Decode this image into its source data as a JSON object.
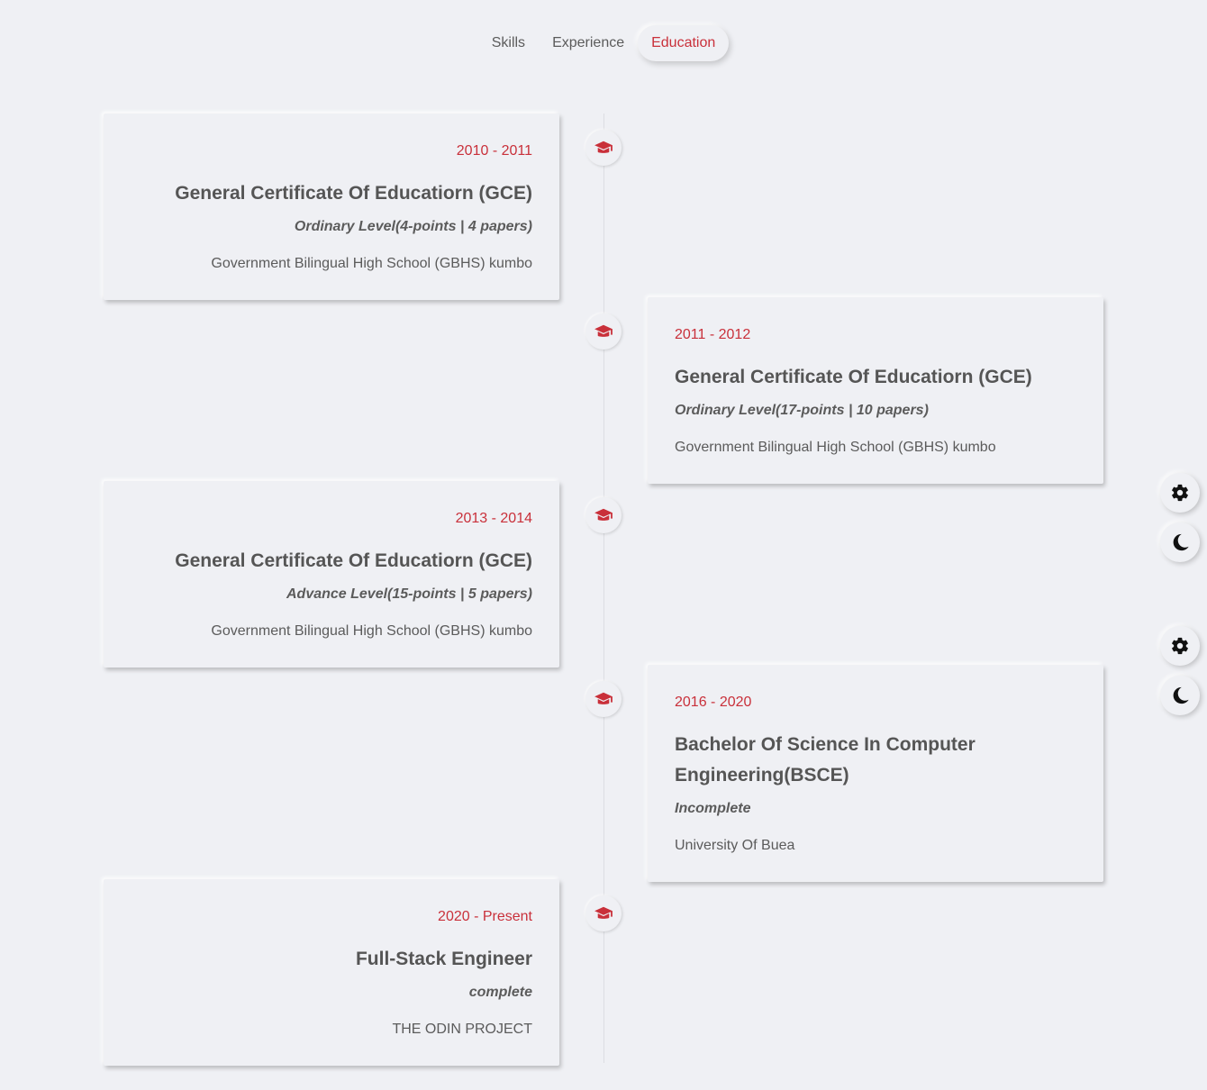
{
  "tabs": [
    {
      "label": "Skills"
    },
    {
      "label": "Experience"
    },
    {
      "label": "Education"
    }
  ],
  "active_tab": "Education",
  "accent_color": "#c9303a",
  "icons": {
    "timeline_marker": "graduation-cap-icon",
    "settings": "gear-icon",
    "theme": "moon-icon"
  },
  "education": [
    {
      "date": "2010 - 2011",
      "title": "General Certificate Of Educatiorn (GCE)",
      "level": "Ordinary Level(4-points | 4 papers)",
      "school": "Government Bilingual High School (GBHS) kumbo"
    },
    {
      "date": "2011 - 2012",
      "title": "General Certificate Of Educatiorn (GCE)",
      "level": "Ordinary Level(17-points | 10 papers)",
      "school": "Government Bilingual High School (GBHS) kumbo"
    },
    {
      "date": "2013 - 2014",
      "title": "General Certificate Of Educatiorn (GCE)",
      "level": "Advance Level(15-points | 5 papers)",
      "school": "Government Bilingual High School (GBHS) kumbo"
    },
    {
      "date": "2016 - 2020",
      "title": "Bachelor Of Science In Computer Engineering(BSCE)",
      "level": "Incomplete",
      "school": "University Of Buea"
    },
    {
      "date": "2020 - Present",
      "title": "Full-Stack Engineer",
      "level": "complete",
      "school": "THE ODIN PROJECT"
    }
  ]
}
